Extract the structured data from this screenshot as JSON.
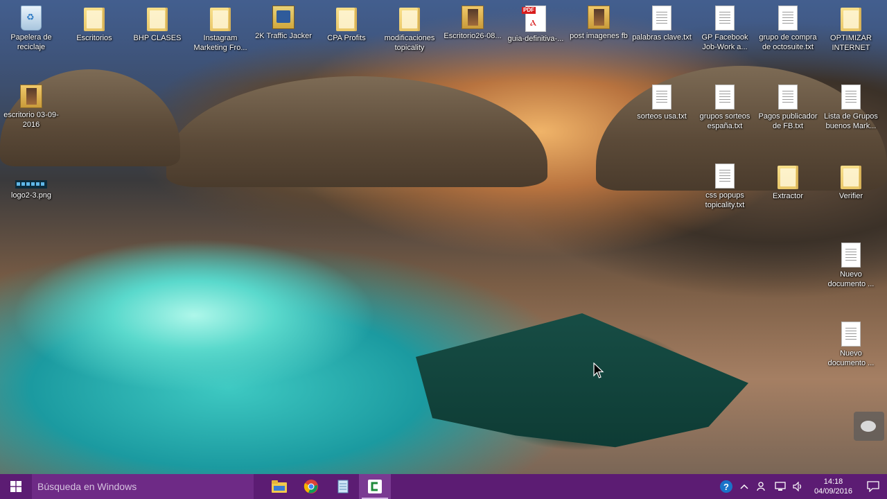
{
  "desktop": {
    "icons": [
      {
        "label": "Papelera de reciclaje",
        "type": "bin"
      },
      {
        "label": "Escritorios",
        "type": "folder"
      },
      {
        "label": "BHP CLASES",
        "type": "folder"
      },
      {
        "label": "Instagram Marketing Fro...",
        "type": "folder"
      },
      {
        "label": "2K Traffic Jacker",
        "type": "app"
      },
      {
        "label": "CPA Profits",
        "type": "folder"
      },
      {
        "label": "modificaciones topicality",
        "type": "folder"
      },
      {
        "label": "Escritorio26-08...",
        "type": "image"
      },
      {
        "label": "guia-definitiva-...",
        "type": "pdf",
        "badge": "PDF"
      },
      {
        "label": "post imagenes fb",
        "type": "image"
      },
      {
        "label": "palabras clave.txt",
        "type": "txt"
      },
      {
        "label": "GP Facebook Job-Work a...",
        "type": "txt"
      },
      {
        "label": "grupo de compra de octosuite.txt",
        "type": "txt"
      },
      {
        "label": "OPTIMIZAR INTERNET",
        "type": "folder"
      },
      {
        "label": "escritorio 03-09-2016",
        "type": "image"
      },
      {
        "label": "sorteos usa.txt",
        "type": "txt"
      },
      {
        "label": "grupos sorteos españa.txt",
        "type": "txt"
      },
      {
        "label": "Pagos publicador de FB.txt",
        "type": "txt"
      },
      {
        "label": "Lista de Grupos buenos Mark...",
        "type": "txt"
      },
      {
        "label": "logo2-3.png",
        "type": "png"
      },
      {
        "label": "css popups topicality.txt",
        "type": "txt"
      },
      {
        "label": "Extractor",
        "type": "folder"
      },
      {
        "label": "Verifier",
        "type": "folder"
      },
      {
        "label": "Nuevo documento ...",
        "type": "txt"
      },
      {
        "label": "Nuevo documento ...",
        "type": "txt"
      }
    ]
  },
  "taskbar": {
    "search_placeholder": "Búsqueda en Windows",
    "apps": [
      {
        "name": "file-explorer"
      },
      {
        "name": "chrome"
      },
      {
        "name": "notepad"
      },
      {
        "name": "camtasia",
        "active": true
      }
    ],
    "clock": {
      "time": "14:18",
      "date": "04/09/2016"
    },
    "colors": {
      "bar": "#5c1c73",
      "search": "#6e2a86"
    }
  }
}
